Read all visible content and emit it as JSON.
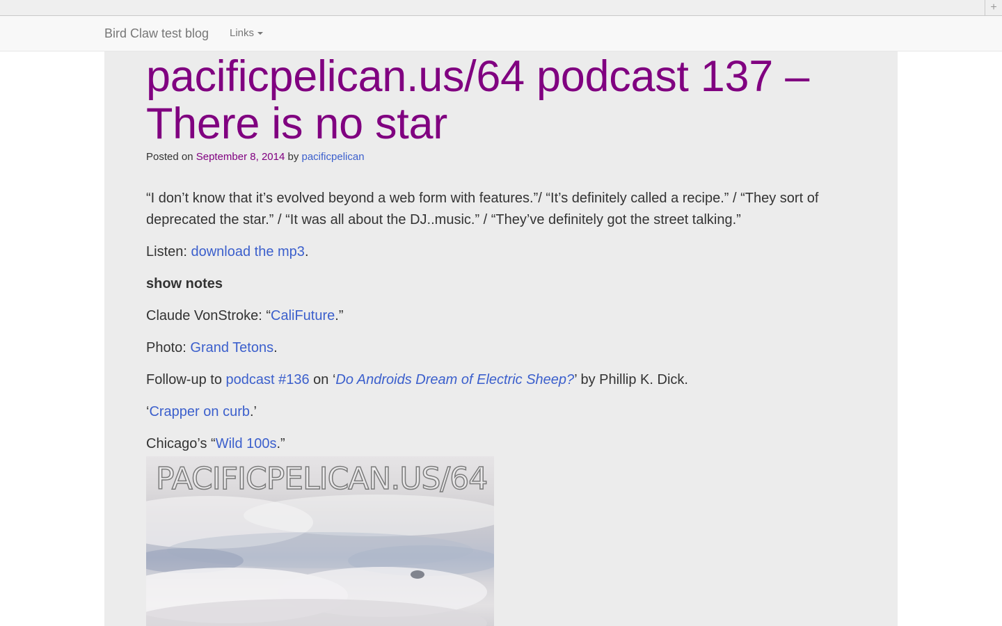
{
  "browser": {
    "new_tab_label": "+"
  },
  "navbar": {
    "brand": "Bird Claw test blog",
    "links_label": "Links"
  },
  "post": {
    "title": "pacificpelican.us/64 podcast 137 – There is no star",
    "meta": {
      "posted_on": "Posted on ",
      "date": "September 8, 2014",
      "by": " by ",
      "author": "pacificpelican"
    },
    "quote": "“I don’t know that it’s evolved beyond a web form with features.”/ “It’s definitely called a recipe.” / “They sort of deprecated the star.” / “It was all about the DJ..music.” / “They’ve definitely got the street talking.”",
    "listen": {
      "prefix": "Listen: ",
      "link": "download the mp3",
      "suffix": "."
    },
    "show_notes_heading": "show notes",
    "claude": {
      "prefix": "Claude VonStroke: “",
      "link": "CaliFuture",
      "suffix": ".”"
    },
    "photo": {
      "prefix": "Photo: ",
      "link": "Grand Tetons",
      "suffix": "."
    },
    "followup": {
      "prefix": "Follow-up to ",
      "link1": "podcast #136",
      "middle": " on ‘",
      "link2": "Do Androids Dream of Electric Sheep?",
      "suffix": "’ by Phillip K. Dick."
    },
    "crapper": {
      "prefix": "‘",
      "link": "Crapper on curb",
      "suffix": ".’"
    },
    "chicago": {
      "prefix": "Chicago’s “",
      "link": "Wild 100s",
      "suffix": ".”"
    },
    "cover_text": "PACIFICPELICAN.US/64"
  },
  "colors": {
    "title": "#800080",
    "link": "#3b5fcc",
    "content_bg": "#ececec"
  }
}
